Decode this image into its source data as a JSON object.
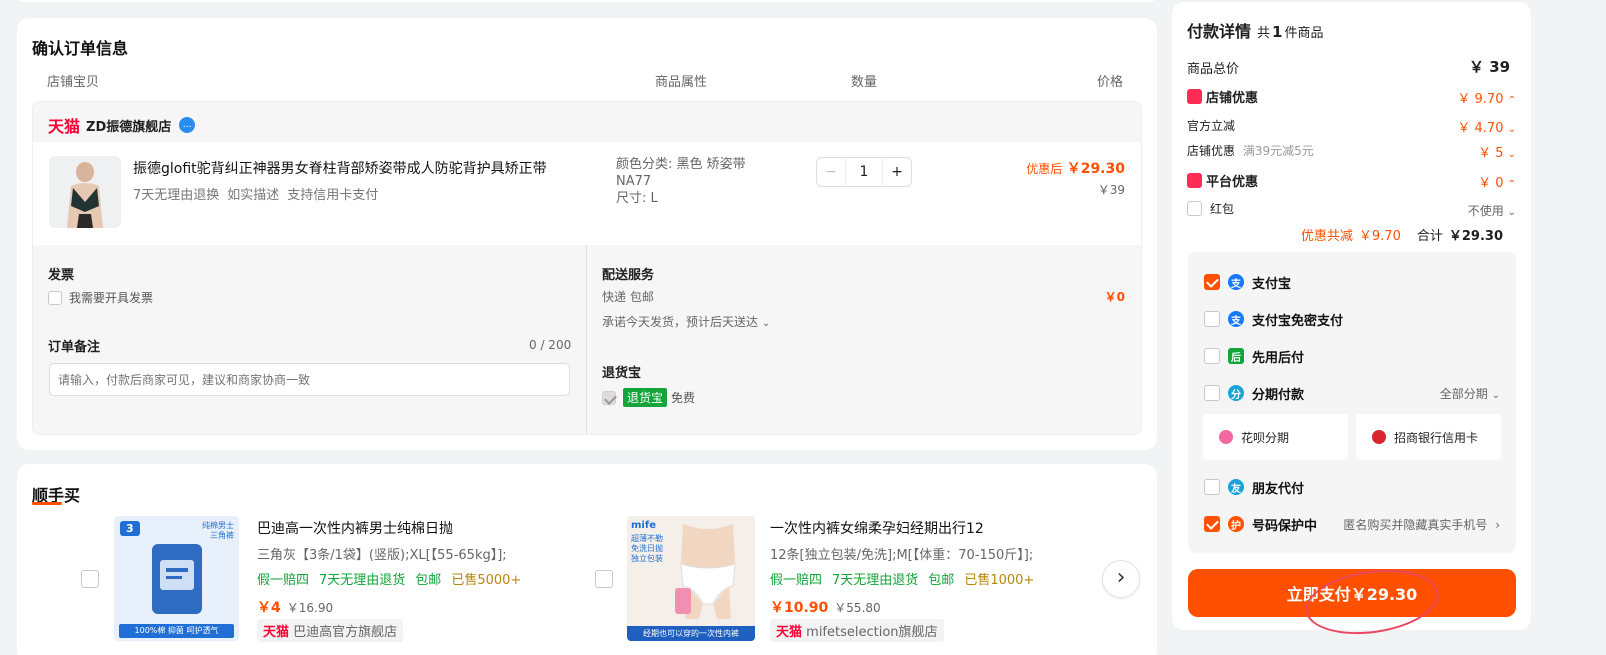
{
  "order": {
    "title": "确认订单信息",
    "headers": {
      "product": "店铺宝贝",
      "attr": "商品属性",
      "qty": "数量",
      "price": "价格"
    },
    "shop": {
      "brand": "天猫",
      "name": "ZD振德旗舰店"
    },
    "item": {
      "name": "振德glofit驼背纠正神器男女脊柱背部矫姿带成人防驼背护具矫正带",
      "services": [
        "7天无理由退换",
        "如实描述",
        "支持信用卡支付"
      ],
      "attr_lines": [
        "颜色分类: 黑色 矫姿带",
        "NA77",
        "尺寸: L"
      ],
      "qty": "1",
      "qty_minus": "−",
      "qty_plus": "+",
      "discount_label": "优惠后",
      "discount_price": "￥29.30",
      "orig_price": "￥39"
    },
    "invoice": {
      "title": "发票",
      "option": "我需要开具发票"
    },
    "remark": {
      "title": "订单备注",
      "counter": "0 / 200",
      "placeholder": "请输入，付款后商家可见，建议和商家协商一致"
    },
    "delivery": {
      "title": "配送服务",
      "method": "快递 包邮",
      "price": "￥0",
      "promise": "承诺今天发货，预计后天送达"
    },
    "return": {
      "title": "退货宝",
      "badge": "退货宝",
      "note": "免费"
    }
  },
  "recommend": {
    "title": "顺手买",
    "items": [
      {
        "name": "巴迪高一次性内裤男士纯棉日抛",
        "spec": "三角灰【3条/1袋】(竖版);XL[【55-65kg】];",
        "tags": [
          "假一赔四",
          "7天无理由退货",
          "包邮"
        ],
        "sold": "已售5000+",
        "price": "￥4",
        "orig": "￥16.90",
        "brand": "天猫",
        "shop": "巴迪高官方旗舰店",
        "img_badge": "3",
        "img_text": "纯棉男士 三角裤",
        "img_caption": "100%棉 抑菌 呵护透气"
      },
      {
        "name": "一次性内裤女绵柔孕妇经期出行12",
        "spec": "12条[独立包装/免洗];M[【体重：70-150斤】];",
        "tags": [
          "假一赔四",
          "7天无理由退货",
          "包邮"
        ],
        "sold": "已售1000+",
        "price": "￥10.90",
        "orig": "￥55.80",
        "brand": "天猫",
        "shop": "mifetselection旗舰店",
        "img_badge": "mife",
        "img_text": "超薄不勒 免洗日抛 独立包装",
        "img_caption": "经期也可以穿的一次性内裤"
      }
    ],
    "next": "›"
  },
  "payment": {
    "title": "付款详情",
    "count_prefix": "共",
    "count": "1",
    "count_suffix": "件商品",
    "total_label": "商品总价",
    "total_value": "￥ 39",
    "shop_discount_label": "店铺优惠",
    "shop_discount_value": "￥ 9.70",
    "official_label": "官方立减",
    "official_value": "￥ 4.70",
    "store_label": "店铺优惠",
    "store_note": "满39元减5元",
    "store_value": "￥ 5",
    "platform_label": "平台优惠",
    "platform_value": "￥ 0",
    "redpacket_label": "红包",
    "redpacket_value": "不使用",
    "saved_label": "优惠共减",
    "saved_value": "￥9.70",
    "sum_label": "合计",
    "sum_value": "￥29.30",
    "methods": [
      {
        "label": "支付宝",
        "checked": true,
        "icon": "支",
        "color": "#1677ff"
      },
      {
        "label": "支付宝免密支付",
        "checked": false,
        "icon": "支",
        "color": "#1677ff"
      },
      {
        "label": "先用后付",
        "checked": false,
        "icon": "后",
        "color": "#13a43a"
      },
      {
        "label": "分期付款",
        "checked": false,
        "icon": "分",
        "color": "#1aa3d8",
        "extra": "全部分期"
      }
    ],
    "installments": [
      "花呗分期",
      "招商银行信用卡"
    ],
    "friend": {
      "label": "朋友代付",
      "icon": "友",
      "color": "#1aa3d8"
    },
    "privacy": {
      "label": "号码保护中",
      "note": "匿名购买并隐藏真实手机号",
      "icon": "护",
      "color": "#ff5000"
    },
    "pay_button": "立即支付￥29.30"
  }
}
